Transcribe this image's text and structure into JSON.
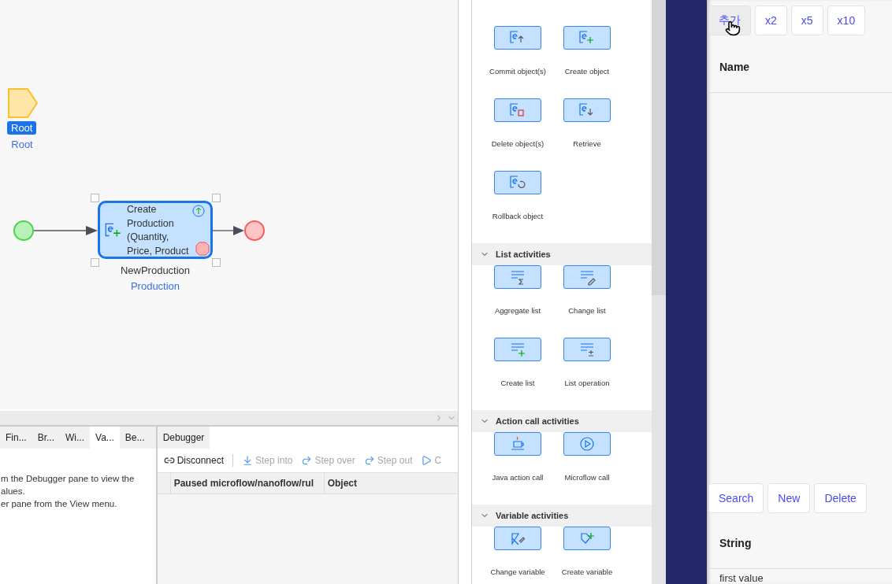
{
  "canvas": {
    "annotation": {
      "badge": "Root",
      "caption": "Root"
    },
    "activity": {
      "text": "Create Production (Quantity, Price, Product",
      "output_name": "NewProduction",
      "output_type": "Production",
      "selected": true
    }
  },
  "bottom_left_pane": {
    "tabs": [
      {
        "label": "Fin...",
        "selected": false
      },
      {
        "label": "Br...",
        "selected": false
      },
      {
        "label": "Wi...",
        "selected": false
      },
      {
        "label": "Va...",
        "selected": true
      },
      {
        "label": "Be...",
        "selected": false
      }
    ],
    "lines": [
      "m the Debugger pane to view the",
      "alues.",
      "er pane from the View menu."
    ]
  },
  "debugger": {
    "tabs": [
      {
        "label": "Debugger",
        "selected": true
      }
    ],
    "toolbar": [
      {
        "label": "Disconnect",
        "disabled": false
      },
      {
        "label": "Step into",
        "disabled": true
      },
      {
        "label": "Step over",
        "disabled": true
      },
      {
        "label": "Step out",
        "disabled": true
      },
      {
        "label": "C",
        "disabled": true
      }
    ],
    "columns": [
      "Paused microflow/nanoflow/rul",
      "Object"
    ]
  },
  "toolbox": [
    {
      "kind": "grid",
      "items": [
        "Commit object(s)",
        "Create object",
        "Delete object(s)",
        "Retrieve",
        "Rollback object"
      ]
    },
    {
      "kind": "section",
      "title": "List activities",
      "expanded": true
    },
    {
      "kind": "grid",
      "items": [
        "Aggregate list",
        "Change list",
        "Create list",
        "List operation"
      ]
    },
    {
      "kind": "section",
      "title": "Action call activities",
      "expanded": true
    },
    {
      "kind": "grid",
      "items": [
        "Java action call",
        "Microflow call"
      ]
    },
    {
      "kind": "section",
      "title": "Variable activities",
      "expanded": true
    },
    {
      "kind": "grid",
      "items": [
        "Change variable",
        "Create variable"
      ]
    }
  ],
  "web_app": {
    "top_buttons": [
      {
        "label": "추가",
        "hovered": true
      },
      {
        "label": "x2",
        "hovered": false
      },
      {
        "label": "x5",
        "hovered": false
      },
      {
        "label": "x10",
        "hovered": false
      }
    ],
    "name_header": "Name",
    "actions": [
      {
        "label": "Search"
      },
      {
        "label": "New"
      },
      {
        "label": "Delete"
      }
    ],
    "string_header": "String",
    "first_row": "first value"
  }
}
